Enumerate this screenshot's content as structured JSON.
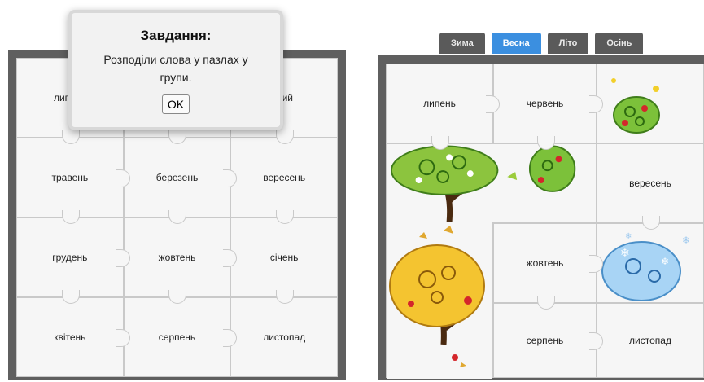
{
  "dialog": {
    "title": "Завдання:",
    "message": "Розподіли слова у пазлах у групи.",
    "ok_label": "OK"
  },
  "left_board": {
    "pieces": [
      "липень",
      "",
      "...ий",
      "травень",
      "березень",
      "вересень",
      "грудень",
      "жовтень",
      "січень",
      "квітень",
      "серпень",
      "листопад"
    ]
  },
  "tabs": [
    {
      "label": "Зима",
      "active": false
    },
    {
      "label": "Весна",
      "active": true
    },
    {
      "label": "Літо",
      "active": false
    },
    {
      "label": "Осінь",
      "active": false
    }
  ],
  "right_board": {
    "pieces": [
      "липень",
      "червень",
      "",
      "",
      "",
      "вересень",
      "",
      "жовтень",
      "",
      "",
      "серпень",
      "листопад"
    ]
  },
  "colors": {
    "board_frame": "#5f5f5f",
    "tab_active": "#3b8fe0",
    "tab_inactive": "#5a5a5a",
    "piece_fill": "#f6f6f6"
  }
}
